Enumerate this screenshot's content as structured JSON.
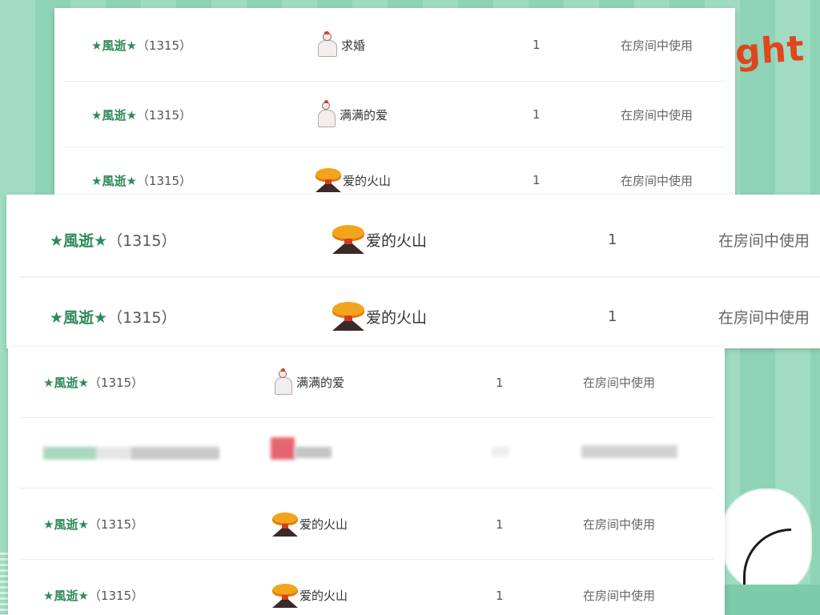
{
  "background": {
    "decoration_text": "ght"
  },
  "columns": {
    "user_label_suffix": "",
    "status_text": "在房间中使用"
  },
  "panel_top": {
    "rows": [
      {
        "user": "★風逝★",
        "uid": "（1315）",
        "gift_icon": "proposal-icon",
        "gift": "求婚",
        "qty": "1",
        "status": "在房间中使用"
      },
      {
        "user": "★風逝★",
        "uid": "（1315）",
        "gift_icon": "full-love-icon",
        "gift": "满满的爱",
        "qty": "1",
        "status": "在房间中使用"
      },
      {
        "user": "★風逝★",
        "uid": "（1315）",
        "gift_icon": "volcano-icon",
        "gift": "爱的火山",
        "qty": "1",
        "status": "在房间中使用"
      }
    ]
  },
  "panel_middle": {
    "rows": [
      {
        "user": "★風逝★",
        "uid": "（1315）",
        "gift_icon": "volcano-icon",
        "gift": "爱的火山",
        "qty": "1",
        "status": "在房间中使用"
      },
      {
        "user": "★風逝★",
        "uid": "（1315）",
        "gift_icon": "volcano-icon",
        "gift": "爱的火山",
        "qty": "1",
        "status": "在房间中使用"
      }
    ]
  },
  "panel_bottom": {
    "rows": [
      {
        "user": "★風逝★",
        "uid": "（1315）",
        "gift_icon": "full-love-icon",
        "gift": "满满的爱",
        "qty": "1",
        "status": "在房间中使用"
      },
      {
        "redacted": true
      },
      {
        "user": "★風逝★",
        "uid": "（1315）",
        "gift_icon": "volcano-icon",
        "gift": "爱的火山",
        "qty": "1",
        "status": "在房间中使用"
      },
      {
        "user": "★風逝★",
        "uid": "（1315）",
        "gift_icon": "volcano-icon",
        "gift": "爱的火山",
        "qty": "1",
        "status": "在房间中使用"
      }
    ]
  },
  "colors": {
    "accent_green": "#2f8a5a",
    "bg_mint": "#9fdcc2",
    "deco_orange": "#e0461e"
  }
}
